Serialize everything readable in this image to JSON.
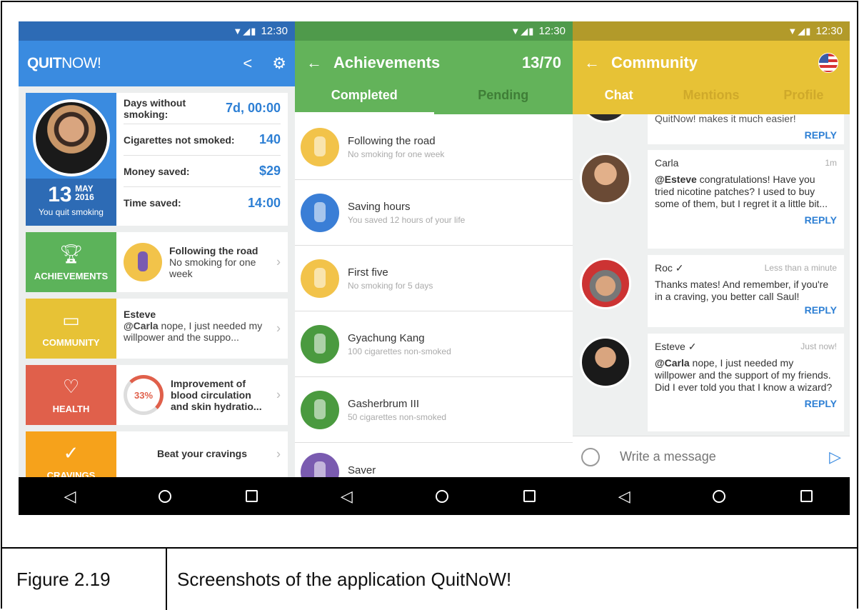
{
  "status": {
    "time": "12:30"
  },
  "screen1": {
    "logo_bold": "QUIT",
    "logo_light": "NOW!",
    "quit_day": "13",
    "quit_month": "MAY",
    "quit_year": "2016",
    "quit_label": "You quit smoking",
    "stats": [
      {
        "label": "Days without smoking:",
        "value": "7d, 00:00"
      },
      {
        "label": "Cigarettes not smoked:",
        "value": "140"
      },
      {
        "label": "Money saved:",
        "value": "$29"
      },
      {
        "label": "Time saved:",
        "value": "14:00"
      }
    ],
    "achievements": {
      "label": "ACHIEVEMENTS",
      "title": "Following the road",
      "desc": "No smoking for one week"
    },
    "community": {
      "label": "COMMUNITY",
      "author": "Esteve",
      "mention": "@Carla",
      "text": " nope, I just needed my willpower and the suppo..."
    },
    "health": {
      "label": "HEALTH",
      "percent": "33%",
      "text": "Improvement of blood circulation and skin hydratio..."
    },
    "cravings": {
      "label": "CRAVINGS",
      "text": "Beat your cravings"
    },
    "colors": {
      "blue": "#3a8be0",
      "green": "#5cb35a",
      "yellow": "#e7c236",
      "red": "#e0604b",
      "orange": "#f6a21b"
    }
  },
  "screen2": {
    "title": "Achievements",
    "count": "13/70",
    "tabs": [
      "Completed",
      "Pending"
    ],
    "items": [
      {
        "title": "Following the road",
        "sub": "No smoking for one week",
        "color": "#f2c34a"
      },
      {
        "title": "Saving hours",
        "sub": "You saved 12 hours of your life",
        "color": "#3a7ed6"
      },
      {
        "title": "First five",
        "sub": "No smoking for 5 days",
        "color": "#f2c34a"
      },
      {
        "title": "Gyachung Kang",
        "sub": "100 cigarettes non-smoked",
        "color": "#4a9a3f"
      },
      {
        "title": "Gasherbrum III",
        "sub": "50 cigarettes non-smoked",
        "color": "#4a9a3f"
      },
      {
        "title": "Saver",
        "sub": "",
        "color": "#7a5bb0"
      }
    ]
  },
  "screen3": {
    "title": "Community",
    "tabs": [
      "Chat",
      "Mentions",
      "Profile"
    ],
    "partial_message": "QuitNow! makes it much easier!",
    "reply_label": "REPLY",
    "messages": [
      {
        "author": "Carla",
        "time": "1m",
        "mention": "@Esteve",
        "text": " congratulations! Have you tried nicotine patches? I used to buy some of them, but I regret it a little bit..."
      },
      {
        "author": "Roc ✓",
        "time": "Less than a minute",
        "mention": "",
        "text": "Thanks mates! And remember, if you're in a craving, you better call Saul!"
      },
      {
        "author": "Esteve ✓",
        "time": "Just now!",
        "mention": "@Carla",
        "text": " nope, I just needed my willpower and the support of my friends. Did I ever told you that I know a wizard?"
      }
    ],
    "compose_placeholder": "Write a message"
  },
  "caption": {
    "number": "Figure 2.19",
    "text": "Screenshots of the application QuitNoW!"
  }
}
